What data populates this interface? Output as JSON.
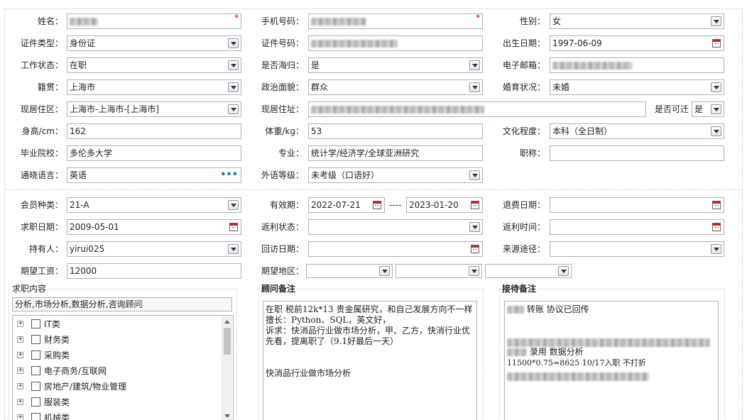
{
  "form": {
    "name": {
      "label": "姓名：",
      "value": "",
      "required": "*"
    },
    "phone": {
      "label": "手机号码：",
      "value": "",
      "required": "*"
    },
    "gender": {
      "label": "性别：",
      "value": "女"
    },
    "id_type": {
      "label": "证件类型：",
      "value": "身份证"
    },
    "id_number": {
      "label": "证件号码：",
      "value": ""
    },
    "birth_date": {
      "label": "出生日期：",
      "value": "1997-06-09"
    },
    "work_status": {
      "label": "工作状态：",
      "value": "在职"
    },
    "returnee": {
      "label": "是否海归：",
      "value": "是"
    },
    "email": {
      "label": "电子邮箱：",
      "value": ""
    },
    "hometown": {
      "label": "籍贯：",
      "value": "上海市"
    },
    "political": {
      "label": "政治面貌：",
      "value": "群众"
    },
    "marital": {
      "label": "婚育状况：",
      "value": "未婚"
    },
    "residence_area": {
      "label": "现居住区：",
      "value": "上海市-上海市-[上海市]"
    },
    "address": {
      "label": "现居住址：",
      "value": ""
    },
    "relocate": {
      "label": "是否可迁",
      "value": "是"
    },
    "height": {
      "label": "身高/cm：",
      "value": "162"
    },
    "weight": {
      "label": "体重/kg：",
      "value": "53"
    },
    "education": {
      "label": "文化程度：",
      "value": "本科（全日制）"
    },
    "school": {
      "label": "毕业院校：",
      "value": "多伦多大学"
    },
    "major": {
      "label": "专业：",
      "value": "统计学/经济学/全球亚洲研究"
    },
    "title": {
      "label": "职称：",
      "value": ""
    },
    "language": {
      "label": "通晓语言：",
      "value": "英语",
      "more": "•••"
    },
    "language_level": {
      "label": "外语等级：",
      "value": "未考级（口语好）"
    }
  },
  "membership": {
    "member_type": {
      "label": "会员种类：",
      "value": "21-A"
    },
    "validity": {
      "label": "有效期：",
      "from": "2022-07-21",
      "sep": "----",
      "to": "2023-01-20"
    },
    "refund_date": {
      "label": "退费日期：",
      "value": ""
    },
    "job_date": {
      "label": "求职日期：",
      "value": "2009-05-01"
    },
    "rebate_status": {
      "label": "返利状态：",
      "value": ""
    },
    "rebate_time": {
      "label": "返利时间：",
      "value": ""
    },
    "holder": {
      "label": "持有人：",
      "value": "yirui025"
    },
    "callback_date": {
      "label": "回访日期：",
      "value": ""
    },
    "source": {
      "label": "来源途径：",
      "value": ""
    },
    "expected_salary": {
      "label": "期望工资：",
      "value": "12000"
    },
    "expected_region": {
      "label": "期望地区：",
      "values": [
        "",
        "",
        ""
      ]
    }
  },
  "job_content": {
    "title": "求职内容",
    "summary": "分析,市场分析,数据分析,咨询顾问",
    "tree": [
      {
        "label": "IT类"
      },
      {
        "label": "财务类"
      },
      {
        "label": "采购类"
      },
      {
        "label": "电子商务/互联网"
      },
      {
        "label": "房地产/建筑/物业管理"
      },
      {
        "label": "服装类"
      },
      {
        "label": "机械类"
      }
    ],
    "expand_symbol": "+"
  },
  "consultant_notes": {
    "title": "顾问备注",
    "text": "在职 税前12k*13 贵金属研究，和自己发展方向不一样\n擅长：Python、SQL，英文好，\n诉求：快消品行业做市场分析，甲、乙方，快消行业优先看，提离职了（9.1好最后一天）\n\n\n快消品行业做市场分析"
  },
  "reception_notes": {
    "title": "接待备注",
    "line1": "转账 协议已回传",
    "line2": "录用 数据分析",
    "line3": "11500*0.75=8625  10/17入职  不打折"
  }
}
